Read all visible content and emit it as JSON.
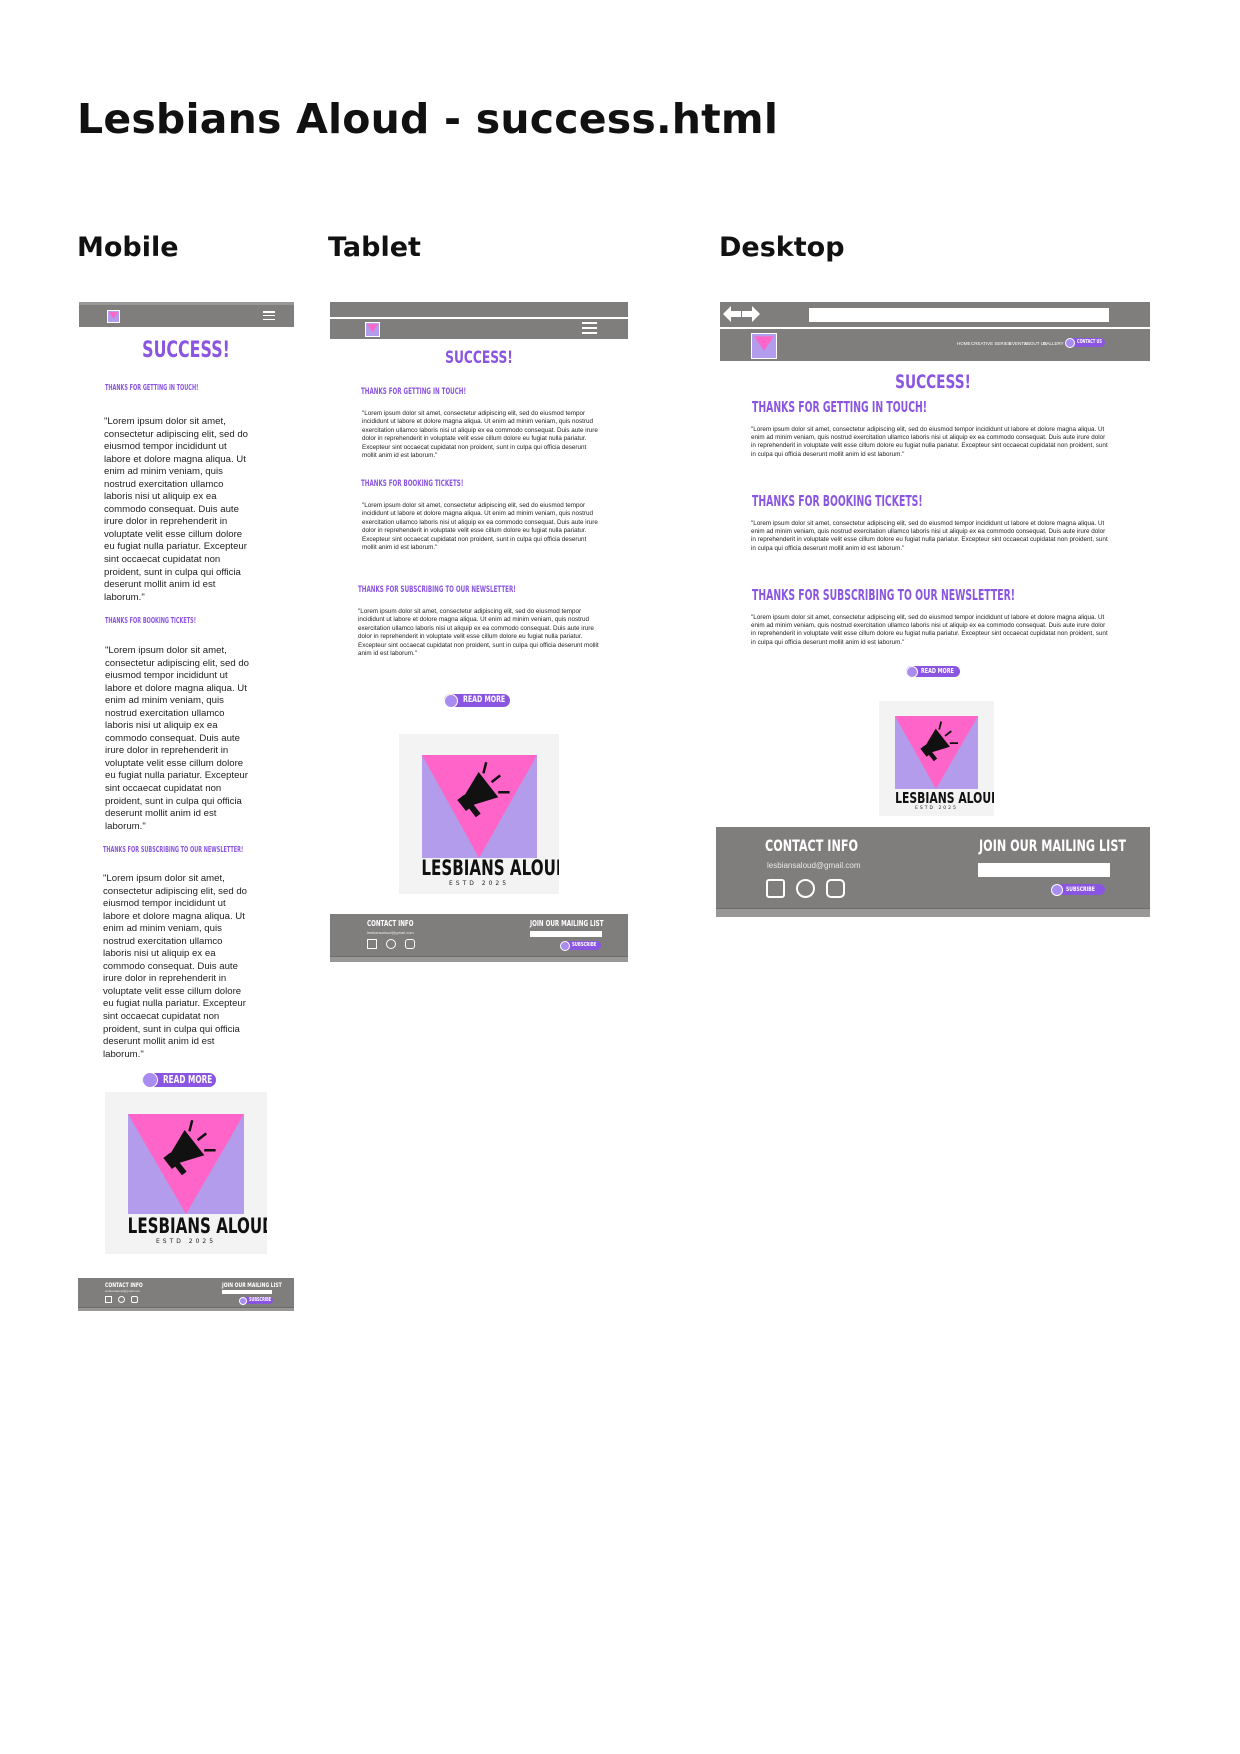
{
  "page": {
    "title": "Lesbians Aloud - success.html",
    "labels": {
      "mobile": "Mobile",
      "tablet": "Tablet",
      "desktop": "Desktop"
    }
  },
  "content": {
    "heading": "SUCCESS!",
    "sections": [
      {
        "title": "THANKS FOR GETTING IN TOUCH!"
      },
      {
        "title": "THANKS FOR BOOKING TICKETS!"
      },
      {
        "title": "THANKS FOR SUBSCRIBING TO OUR NEWSLETTER!"
      }
    ],
    "lorem": "\"Lorem ipsum dolor sit amet, consectetur adipiscing elit, sed do eiusmod tempor incididunt ut labore et dolore magna aliqua. Ut enim ad minim veniam, quis nostrud exercitation ullamco laboris nisi ut aliquip ex ea commodo consequat. Duis aute irure dolor in reprehenderit in voluptate velit esse cillum dolore eu fugiat nulla pariatur. Excepteur sint occaecat cupidatat non proident, sunt in culpa qui officia deserunt mollit anim id est laborum.\"",
    "read_more": "READ MORE"
  },
  "logo": {
    "name": "LESBIANS ALOUD",
    "est": "ESTD 2025"
  },
  "nav": {
    "links": [
      "HOME",
      "CREATIVE SERIES",
      "EVENTS",
      "ABOUT US",
      "GALLERY"
    ],
    "contact_button": "CONTACT US"
  },
  "footer": {
    "contact_title": "CONTACT INFO",
    "email": "lesbiansaloud@gmail.com",
    "mailing_title": "JOIN OUR MAILING LIST",
    "subscribe": "SUBSCRIBE",
    "social_icons": [
      "facebook-icon",
      "x-icon",
      "instagram-icon"
    ]
  },
  "colors": {
    "accent": "#8a55e0",
    "bar": "#807d7d",
    "pink": "#ff64c8",
    "lavender": "#b39ceb"
  }
}
